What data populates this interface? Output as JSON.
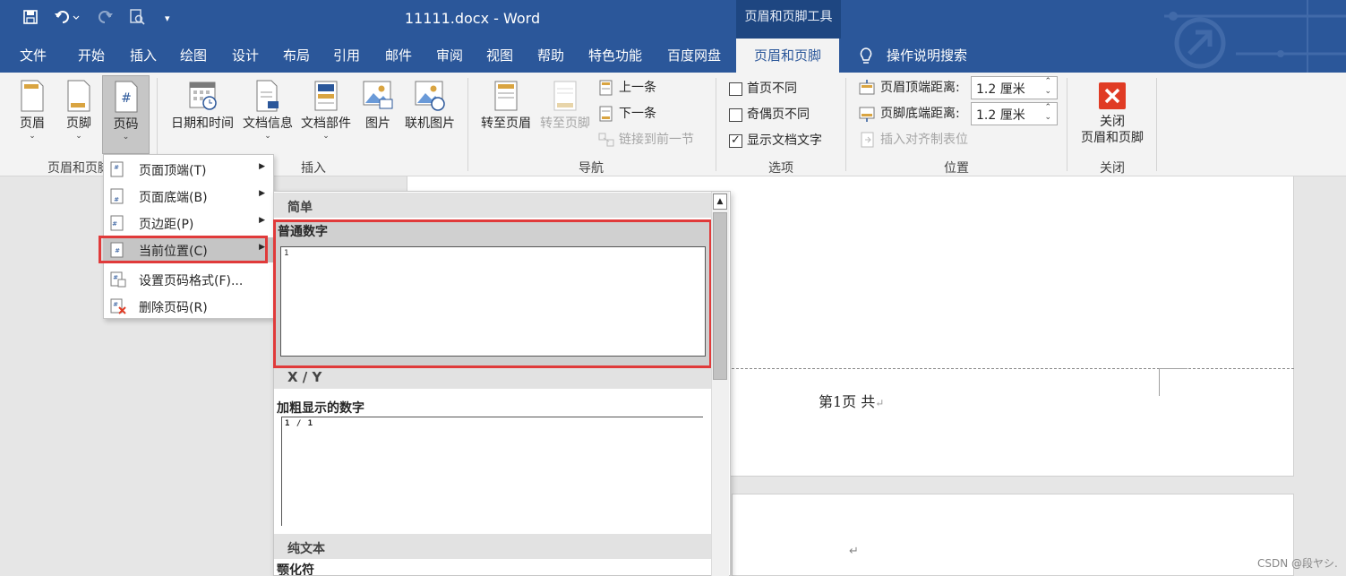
{
  "title_bar": {
    "title": "11111.docx  -  Word",
    "context_group": "页眉和页脚工具"
  },
  "quick_access": [
    "save-icon",
    "undo-icon",
    "redo-icon",
    "print-preview-icon",
    "customize-icon"
  ],
  "tabs": [
    {
      "label": "文件"
    },
    {
      "label": "开始"
    },
    {
      "label": "插入"
    },
    {
      "label": "绘图"
    },
    {
      "label": "设计"
    },
    {
      "label": "布局"
    },
    {
      "label": "引用"
    },
    {
      "label": "邮件"
    },
    {
      "label": "审阅"
    },
    {
      "label": "视图"
    },
    {
      "label": "帮助"
    },
    {
      "label": "特色功能"
    },
    {
      "label": "百度网盘"
    },
    {
      "label": "页眉和页脚"
    }
  ],
  "search_tab": "操作说明搜索",
  "ribbon": {
    "hf_group": {
      "header": "页眉",
      "footer": "页脚",
      "page_number": "页码",
      "label": "页眉和页脚"
    },
    "insert_group": {
      "datetime": "日期和时间",
      "docinfo": "文档信息",
      "parts": "文档部件",
      "picture": "图片",
      "online_picture": "联机图片",
      "label": "插入"
    },
    "nav_group": {
      "goto_header": "转至页眉",
      "goto_footer": "转至页脚",
      "previous": "上一条",
      "next": "下一条",
      "link_previous": "链接到前一节",
      "label": "导航"
    },
    "options_group": {
      "diff_first": "首页不同",
      "diff_odd_even": "奇偶页不同",
      "show_text": "显示文档文字",
      "diff_first_checked": false,
      "diff_odd_even_checked": false,
      "show_text_checked": true,
      "label": "选项"
    },
    "position_group": {
      "header_dist_label": "页眉顶端距离:",
      "header_dist_value": "1.2 厘米",
      "footer_dist_label": "页脚底端距离:",
      "footer_dist_value": "1.2 厘米",
      "insert_tab": "插入对齐制表位",
      "label": "位置"
    },
    "close_group": {
      "close_line1": "关闭",
      "close_line2": "页眉和页脚",
      "label": "关闭"
    }
  },
  "menu": {
    "items": [
      {
        "label": "页面顶端(T)",
        "submenu": true
      },
      {
        "label": "页面底端(B)",
        "submenu": true
      },
      {
        "label": "页边距(P)",
        "submenu": true
      },
      {
        "label": "当前位置(C)",
        "submenu": true
      },
      {
        "label": "设置页码格式(F)...",
        "submenu": false
      },
      {
        "label": "删除页码(R)",
        "submenu": false
      }
    ],
    "hovered_index": 3
  },
  "gallery": {
    "sections": [
      {
        "header": "简单",
        "item_title": "普通数字",
        "preview": "1"
      },
      {
        "header": "X / Y",
        "item_title": "加粗显示的数字",
        "preview": "1 / 1"
      },
      {
        "header": "纯文本",
        "item_title": "颚化符"
      }
    ]
  },
  "document": {
    "footer_text": "第1页  共",
    "para_mark": "↵"
  },
  "watermark": "CSDN @段ヤシ.",
  "colors": {
    "accent": "#2b579a",
    "highlight": "#e03a3a",
    "close_red": "#e03b24"
  }
}
